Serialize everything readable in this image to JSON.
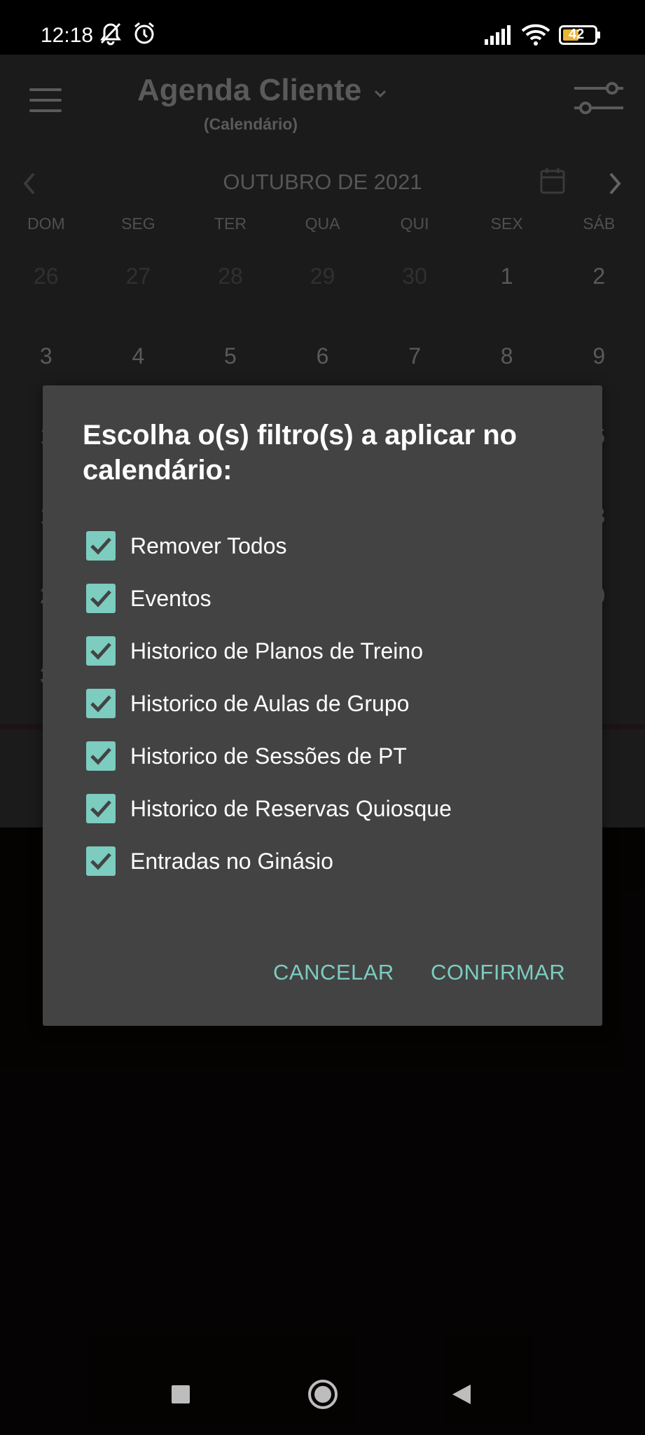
{
  "status_bar": {
    "time": "12:18",
    "battery": "42",
    "icons": [
      "muted-bell-icon",
      "alarm-icon",
      "signal-icon",
      "wifi-icon",
      "battery-icon"
    ]
  },
  "app": {
    "title": "Agenda Cliente",
    "subtitle": "(Calendário)",
    "month": "OUTUBRO DE 2021",
    "weekdays": [
      "DOM",
      "SEG",
      "TER",
      "QUA",
      "QUI",
      "SEX",
      "SÁB"
    ],
    "weeks": [
      [
        "26",
        "27",
        "28",
        "29",
        "30",
        "1",
        "2"
      ],
      [
        "3",
        "4",
        "5",
        "6",
        "7",
        "8",
        "9"
      ],
      [
        "1",
        "",
        "",
        "",
        "",
        "",
        "6"
      ],
      [
        "1",
        "",
        "",
        "",
        "",
        "",
        "3"
      ],
      [
        "2",
        "",
        "",
        "",
        "",
        "",
        "0"
      ],
      [
        "3",
        "",
        "",
        "",
        "",
        "",
        ""
      ]
    ]
  },
  "dialog": {
    "title": "Escolha o(s) filtro(s) a aplicar no calendário:",
    "options": [
      {
        "label": "Remover Todos",
        "checked": true
      },
      {
        "label": "Eventos",
        "checked": true
      },
      {
        "label": "Historico de Planos de Treino",
        "checked": true
      },
      {
        "label": "Historico de Aulas de Grupo",
        "checked": true
      },
      {
        "label": "Historico de Sessões de PT",
        "checked": true
      },
      {
        "label": "Historico de Reservas Quiosque",
        "checked": true
      },
      {
        "label": "Entradas no Ginásio",
        "checked": true
      }
    ],
    "cancel_label": "CANCELAR",
    "confirm_label": "CONFIRMAR"
  },
  "colors": {
    "accent": "#7cccc0",
    "dialog_bg": "#434343",
    "app_bg": "#2a2a2a"
  }
}
